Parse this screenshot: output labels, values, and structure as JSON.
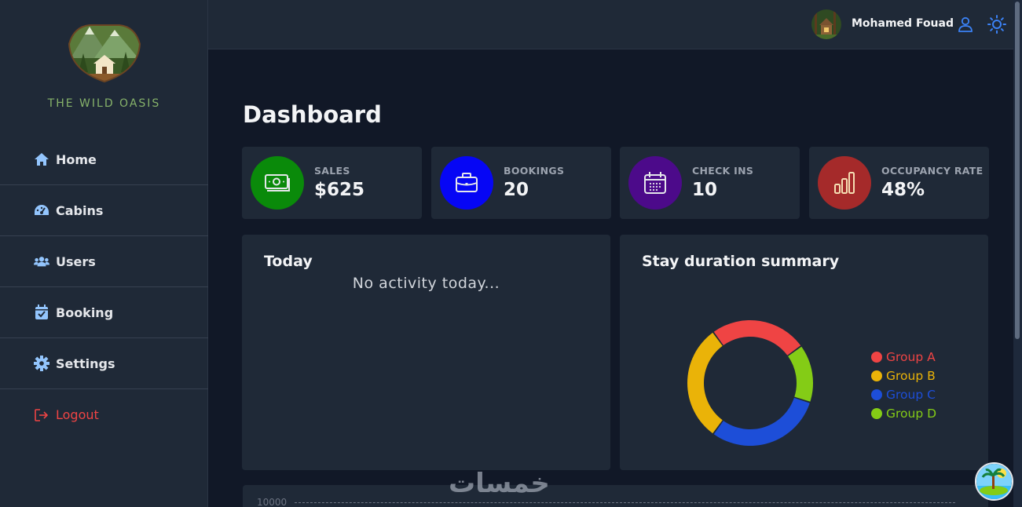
{
  "sidebar": {
    "brand": "THE WILD OASIS",
    "items": [
      {
        "label": "Home",
        "icon": "home-icon"
      },
      {
        "label": "Cabins",
        "icon": "gauge-icon"
      },
      {
        "label": "Users",
        "icon": "users-icon"
      },
      {
        "label": "Booking",
        "icon": "calendar-check-icon"
      },
      {
        "label": "Settings",
        "icon": "gear-icon"
      },
      {
        "label": "Logout",
        "icon": "logout-icon"
      }
    ]
  },
  "header": {
    "username": "Mohamed Fouad",
    "icons": [
      "user-icon",
      "sun-icon"
    ]
  },
  "main": {
    "title": "Dashboard",
    "stats": [
      {
        "label": "SALES",
        "value": "$625",
        "color": "#0a8a0a",
        "icon": "banknotes-icon"
      },
      {
        "label": "BOOKINGS",
        "value": "20",
        "color": "#0606f5",
        "icon": "briefcase-icon"
      },
      {
        "label": "CHECK INS",
        "value": "10",
        "color": "#4c0a8a",
        "icon": "calendar-days-icon"
      },
      {
        "label": "OCCUPANCY RATE",
        "value": "48%",
        "color": "#a52a2a",
        "icon": "chart-bar-icon"
      }
    ],
    "today": {
      "title": "Today",
      "empty_text": "No activity today..."
    },
    "duration": {
      "title": "Stay duration summary",
      "legend": [
        {
          "label": "Group A",
          "color": "#ef4444"
        },
        {
          "label": "Group B",
          "color": "#eab308"
        },
        {
          "label": "Group C",
          "color": "#1d4ed8"
        },
        {
          "label": "Group D",
          "color": "#84cc16"
        }
      ]
    },
    "sales_chart": {
      "y_tick": "10000"
    }
  },
  "chart_data": {
    "type": "pie",
    "variant": "donut",
    "title": "Stay duration summary",
    "series": [
      {
        "name": "Group A",
        "values": [
          25
        ]
      },
      {
        "name": "Group D",
        "values": [
          15
        ]
      },
      {
        "name": "Group C",
        "values": [
          30
        ]
      },
      {
        "name": "Group B",
        "values": [
          30
        ]
      }
    ],
    "legend_position": "right"
  },
  "watermark": "خمسات"
}
